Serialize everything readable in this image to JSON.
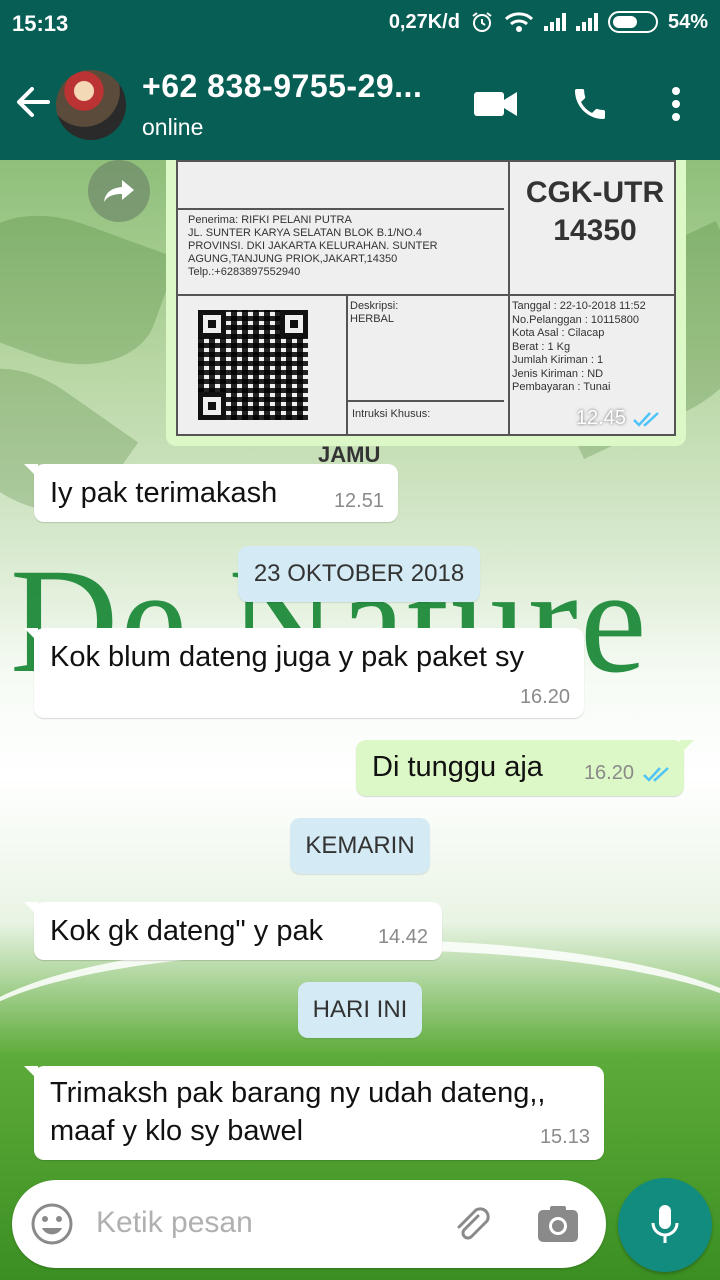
{
  "status_bar": {
    "time": "15:13",
    "network_speed": "0,27K/d",
    "battery": "54%"
  },
  "header": {
    "contact_name": "+62 838-9755-29...",
    "status": "online"
  },
  "background": {
    "watermark_brand": "De Nature",
    "watermark_small": "JAMU"
  },
  "image_message": {
    "time": "12.45",
    "label": {
      "route_code": "CGK-UTR",
      "postal_code": "14350",
      "recipient_lines": [
        "Penerima: RIFKI PELANI PUTRA",
        "JL. SUNTER KARYA SELATAN BLOK B.1/NO.4",
        "PROVINSI. DKI JAKARTA KELURAHAN. SUNTER",
        "AGUNG,TANJUNG PRIOK,JAKART,14350",
        "Telp.:+6283897552940"
      ],
      "description_lines": [
        "Deskripsi:",
        "HERBAL"
      ],
      "instruction": "Intruksi Khusus:",
      "meta_lines": [
        "Tanggal : 22-10-2018 11:52",
        "No.Pelanggan : 10115800",
        "Kota Asal : Cilacap",
        "Berat : 1 Kg",
        "Jumlah Kiriman : 1",
        "Jenis Kiriman : ND",
        "Pembayaran : Tunai"
      ]
    }
  },
  "messages": [
    {
      "type": "in",
      "text": "Iy pak terimakash",
      "time": "12.51"
    },
    {
      "type": "date",
      "text": "23 OKTOBER 2018"
    },
    {
      "type": "in",
      "text": "Kok blum dateng juga y pak paket sy",
      "time": "16.20"
    },
    {
      "type": "out",
      "text": "Di tunggu aja",
      "time": "16.20"
    },
    {
      "type": "date",
      "text": "KEMARIN"
    },
    {
      "type": "in",
      "text": "Kok gk dateng\" y pak",
      "time": "14.42"
    },
    {
      "type": "date",
      "text": "HARI INI"
    },
    {
      "type": "in",
      "text_lines": [
        "Trimaksh pak barang ny udah dateng,,",
        "maaf y klo sy bawel"
      ],
      "time": "15.13"
    }
  ],
  "input": {
    "placeholder": "Ketik pesan"
  },
  "colors": {
    "header": "#075e54",
    "outgoing_bubble": "#dcf8c6",
    "incoming_bubble": "#ffffff",
    "date_chip": "#d4eaf4",
    "read_ticks": "#4fc3f7",
    "fab": "#128c7e"
  }
}
